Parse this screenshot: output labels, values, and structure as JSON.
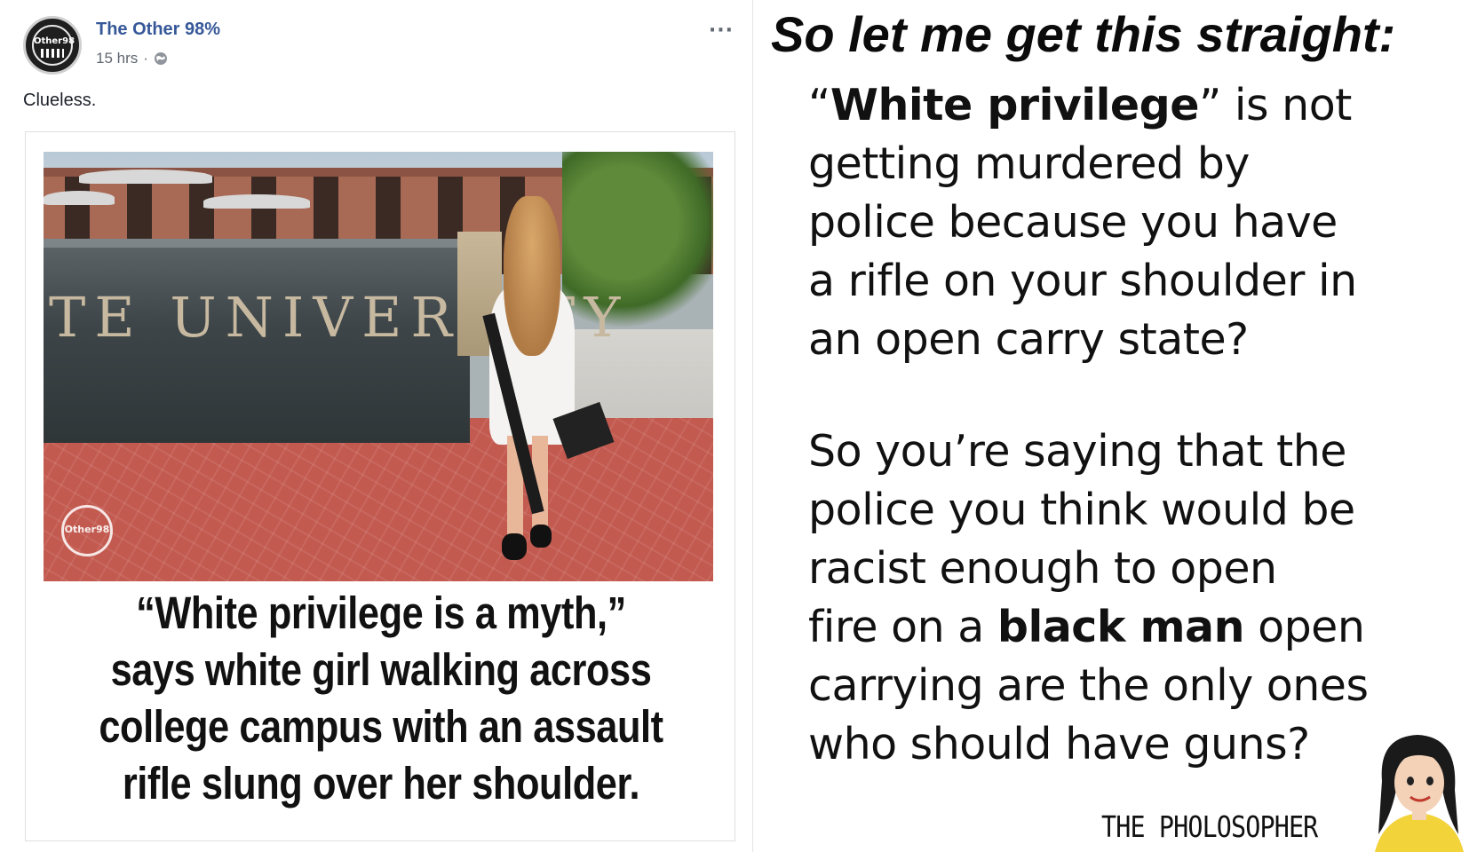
{
  "post": {
    "page_name": "The Other 98%",
    "time": "15 hrs",
    "separator": "·",
    "caption": "Clueless.",
    "avatar_text": "Other98",
    "more_label": "···"
  },
  "shared_image": {
    "wall_text": "TE UNIVERSITY",
    "watermark_text": "Other98",
    "headline_lines": [
      "“White privilege is a myth,”",
      "says white girl walking across",
      "college campus with an assault",
      "rifle slung over her shoulder."
    ]
  },
  "meme": {
    "title": "So let me get this straight:",
    "para1": {
      "line1_open": "“",
      "line1_bold": "White privilege",
      "line1_rest": "” is not",
      "line2": "getting murdered by",
      "line3": "police because you have",
      "line4": "a rifle on your shoulder in",
      "line5": "an open carry state?"
    },
    "para2": {
      "line1": "So you’re saying that the",
      "line2": "police you think would be",
      "line3": "racist enough to open",
      "line4_pre": "fire on a ",
      "line4_bold": "black man",
      "line4_post": " open",
      "line5": "carrying are the only ones",
      "line6": "who should have guns?"
    },
    "signature": "THE PHOLOSOPHER"
  },
  "colors": {
    "page_name": "#365899",
    "meta": "#606770",
    "mascot_shirt": "#f2d33a",
    "mascot_hair": "#1a1a1a"
  },
  "icons": {
    "globe": "globe-icon",
    "more": "more-options-icon"
  }
}
